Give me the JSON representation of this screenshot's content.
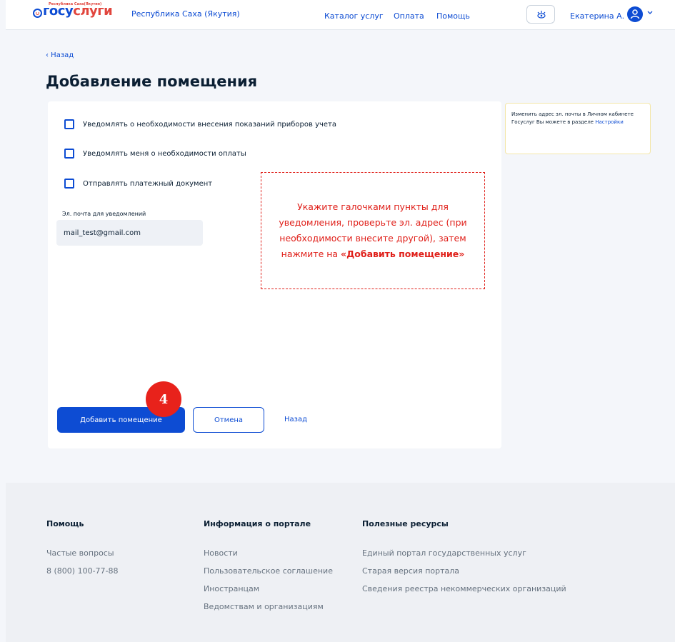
{
  "header": {
    "logo_small": "Республика Саха(Якутия)",
    "logo_main_a": "госу",
    "logo_main_b": "слуги",
    "region": "Республика Саха (Якутия)",
    "nav": [
      "Каталог услуг",
      "Оплата",
      "Помощь"
    ],
    "user_name": "Екатерина А."
  },
  "main": {
    "back_label": "‹ Назад",
    "title": "Добавление помещения",
    "checkboxes": [
      {
        "label": "Уведомлять о необходимости внесения показаний приборов учета",
        "checked": false
      },
      {
        "label": "Уведомлять меня о необходимости оплаты",
        "checked": false
      },
      {
        "label": "Отправлять платежный документ",
        "checked": false
      }
    ],
    "email_label": "Эл. почта для уведомлений",
    "email_value": "mail_test@gmail.com",
    "buttons": {
      "add": "Добавить помещение",
      "cancel": "Отмена",
      "back": "Назад"
    }
  },
  "annotation": {
    "step_number": "4",
    "callout_text": "Укажите галочками пункты для уведомления, проверьте эл. адрес (при необходимости внесите другой), затем нажмите на ",
    "callout_bold": "«Добавить помещение»"
  },
  "info_note": {
    "text": "Изменить адрес эл. почты в Личном кабинете Госуслуг Вы можете в разделе ",
    "link": "Настройки"
  },
  "footer": {
    "columns": [
      {
        "title": "Помощь",
        "items": [
          "Частые вопросы",
          "8 (800) 100-77-88"
        ]
      },
      {
        "title": "Информация о портале",
        "items": [
          "Новости",
          "Пользовательское соглашение",
          "Иностранцам",
          "Ведомствам и организациям"
        ]
      },
      {
        "title": "Полезные ресурсы",
        "items": [
          "Единый портал государственных услуг",
          "Старая версия портала",
          "Сведения реестра некоммерческих организаций"
        ]
      }
    ]
  },
  "colors": {
    "primary": "#0d4cd3",
    "accent_red": "#e1453d",
    "annotation_red": "#e0201a"
  }
}
